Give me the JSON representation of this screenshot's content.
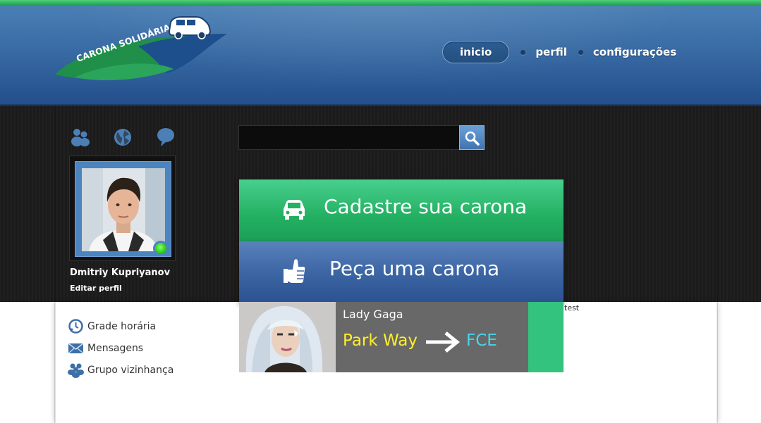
{
  "header": {
    "logo_text": "CARONA SOLIDÁRIA",
    "nav": [
      {
        "label": "inicio",
        "active": true
      },
      {
        "label": "perfil",
        "active": false
      },
      {
        "label": "configurações",
        "active": false
      }
    ]
  },
  "toolbar_icons": [
    "group-icon",
    "globe-icon",
    "chat-bubble-icon"
  ],
  "search": {
    "placeholder": "",
    "value": "",
    "button_icon": "magnifier-icon"
  },
  "profile": {
    "name": "Dmitriy Kupriyanov",
    "edit_label": "Editar perfil",
    "status": "online"
  },
  "side_menu": [
    {
      "label": "Grade horária",
      "icon": "clock-icon"
    },
    {
      "label": "Mensagens",
      "icon": "envelope-icon"
    },
    {
      "label": "Grupo vizinhança",
      "icon": "group-icon"
    }
  ],
  "actions": {
    "offer_ride": {
      "label": "Cadastre sua carona",
      "icon": "car-icon"
    },
    "request_ride": {
      "label": "Peça uma carona",
      "icon": "thumbs-up-icon"
    }
  },
  "ride": {
    "driver": "Lady Gaga",
    "from": "Park Way",
    "to": "FCE"
  },
  "test_label": "test",
  "colors": {
    "header_blue": "#3566a0",
    "green": "#23b062",
    "blue_button": "#3a64a2",
    "from_yellow": "#ffef2a",
    "to_cyan": "#45d6f0"
  }
}
